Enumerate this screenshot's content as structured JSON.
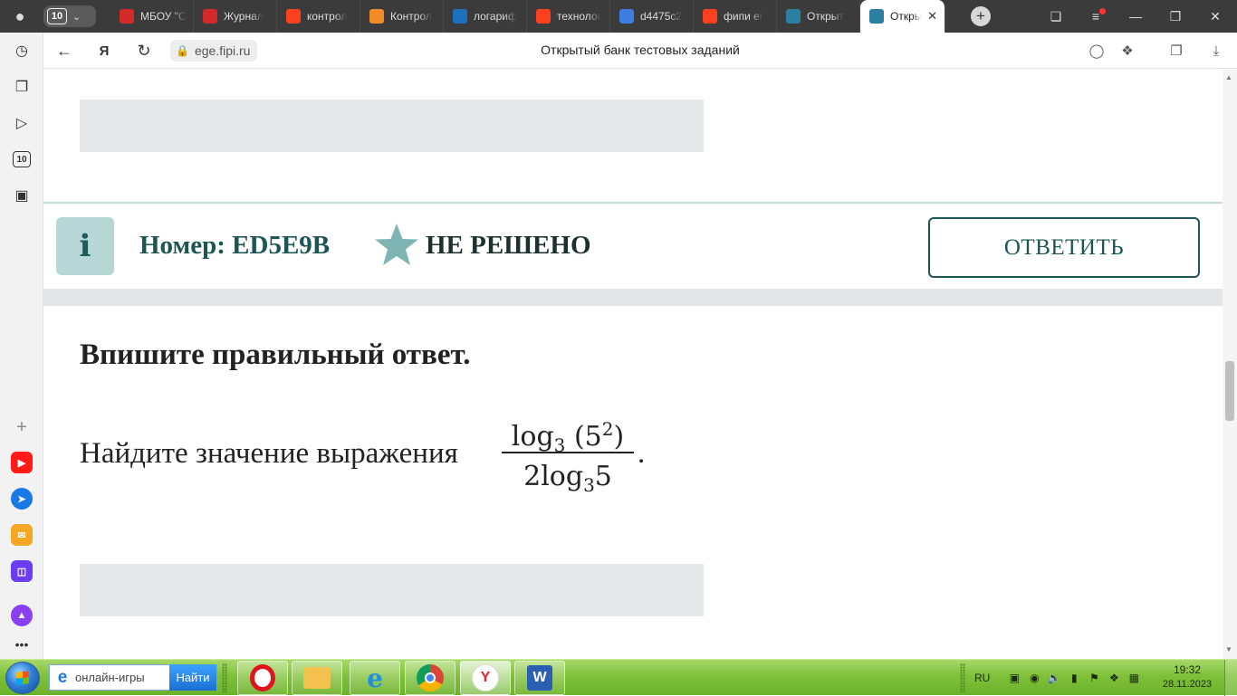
{
  "browser": {
    "tab_counter": "10",
    "tabs": [
      {
        "label": "МБОУ \"С",
        "favicon": "document-red-icon",
        "color": "#d42a2a"
      },
      {
        "label": "Журнал",
        "favicon": "document-red-icon",
        "color": "#d42a2a"
      },
      {
        "label": "контрол",
        "favicon": "yandex-icon",
        "color": "#fc3f1d"
      },
      {
        "label": "Контрол",
        "favicon": "paper-plane-icon",
        "color": "#f08c28"
      },
      {
        "label": "логариф",
        "favicon": "checkmark-icon",
        "color": "#1f6fbf"
      },
      {
        "label": "технолог",
        "favicon": "yandex-icon",
        "color": "#fc3f1d"
      },
      {
        "label": "d4475c2",
        "favicon": "cube-icon",
        "color": "#3d7de0"
      },
      {
        "label": "фипи ег",
        "favicon": "yandex-icon",
        "color": "#fc3f1d"
      },
      {
        "label": "Открыт",
        "favicon": "fipi-icon",
        "color": "#2a7fa0"
      },
      {
        "label": "Откры",
        "favicon": "fipi-icon",
        "color": "#2a7fa0",
        "active": true
      }
    ],
    "domain": "ege.fipi.ru",
    "page_title": "Открытый банк тестовых заданий"
  },
  "sidebar": {
    "badge": "10"
  },
  "task": {
    "info_label": "i",
    "number": "Номер: ED5E9B",
    "status": "НЕ РЕШЕНО",
    "answer_button": "ОТВЕТИТЬ",
    "instruction": "Впишите правильный ответ.",
    "question": "Найдите значение выражения",
    "fraction": {
      "num_fn": "log",
      "num_base": "3",
      "num_open": " (5",
      "num_exp": "2",
      "num_close": ")",
      "den_coef": "2log",
      "den_base": "3",
      "den_arg": "5"
    },
    "period": "."
  },
  "taskbar": {
    "search_placeholder": "онлайн-игры",
    "search_button": "Найти",
    "lang": "RU",
    "time": "19:32",
    "date": "28.11.2023"
  },
  "colors": {
    "accent": "#1c5553",
    "star": "#7fb4b4",
    "info_bg": "#b7d6d6",
    "answer_box": "#e6e9ea"
  }
}
